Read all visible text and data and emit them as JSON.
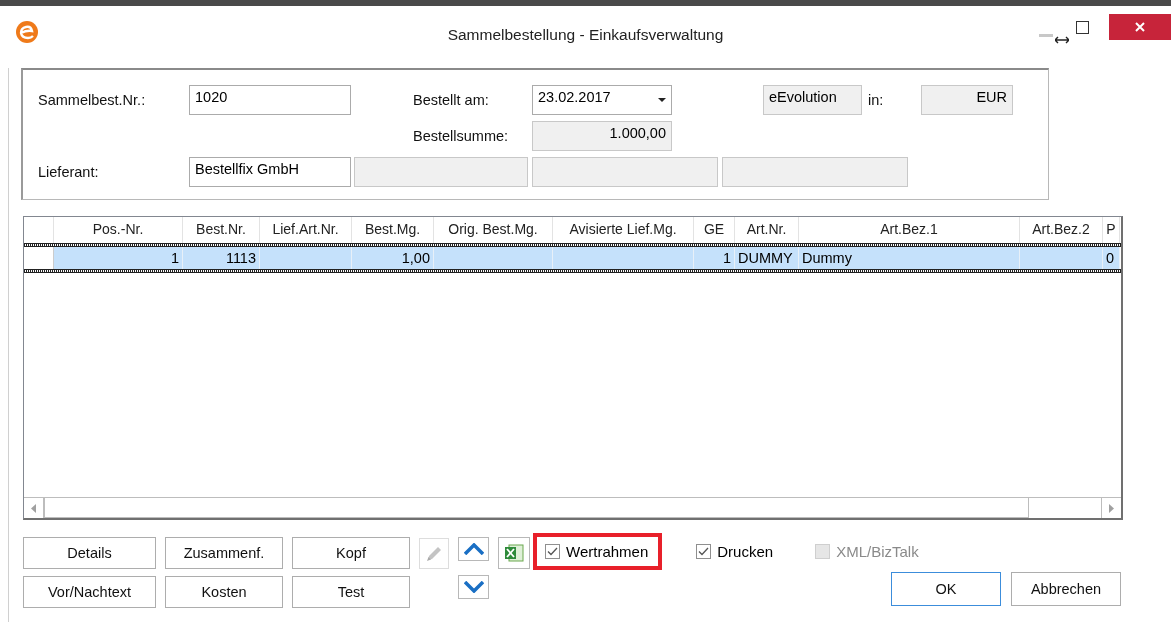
{
  "window": {
    "title": "Sammelbestellung - Einkaufsverwaltung"
  },
  "header": {
    "number_label": "Sammelbest.Nr.:",
    "number_value": "1020",
    "date_label": "Bestellt am:",
    "date_value": "23.02.2017",
    "company": "eEvolution",
    "currency_label": "in:",
    "currency": "EUR",
    "sum_label": "Bestellsumme:",
    "sum_value": "1.000,00",
    "supplier_label": "Lieferant:",
    "supplier_value": "Bestellfix GmbH"
  },
  "table": {
    "columns": [
      "Pos.-Nr.",
      "Best.Nr.",
      "Lief.Art.Nr.",
      "Best.Mg.",
      "Orig. Best.Mg.",
      "Avisierte Lief.Mg.",
      "GE",
      "Art.Nr.",
      "Art.Bez.1",
      "Art.Bez.2",
      "P"
    ],
    "rows": [
      {
        "selected": true,
        "cells": [
          "1",
          "1113",
          "",
          "1,00",
          "",
          "",
          "1",
          "DUMMY",
          "Dummy",
          "",
          "0"
        ]
      }
    ]
  },
  "buttons": [
    {
      "label": "Details"
    },
    {
      "label": "Zusammenf."
    },
    {
      "label": "Kopf"
    },
    {
      "label": "Vor/Nachtext"
    },
    {
      "label": "Kosten"
    },
    {
      "label": "Test"
    }
  ],
  "options": [
    {
      "label": "Wertrahmen",
      "checked": true,
      "disabled": false,
      "highlighted": true
    },
    {
      "label": "Drucken",
      "checked": true,
      "disabled": false,
      "highlighted": false
    },
    {
      "label": "XML/BizTalk",
      "checked": false,
      "disabled": true,
      "highlighted": false
    }
  ],
  "dialog_buttons": [
    {
      "label": "OK",
      "default": true
    },
    {
      "label": "Abbrechen",
      "default": false
    }
  ]
}
